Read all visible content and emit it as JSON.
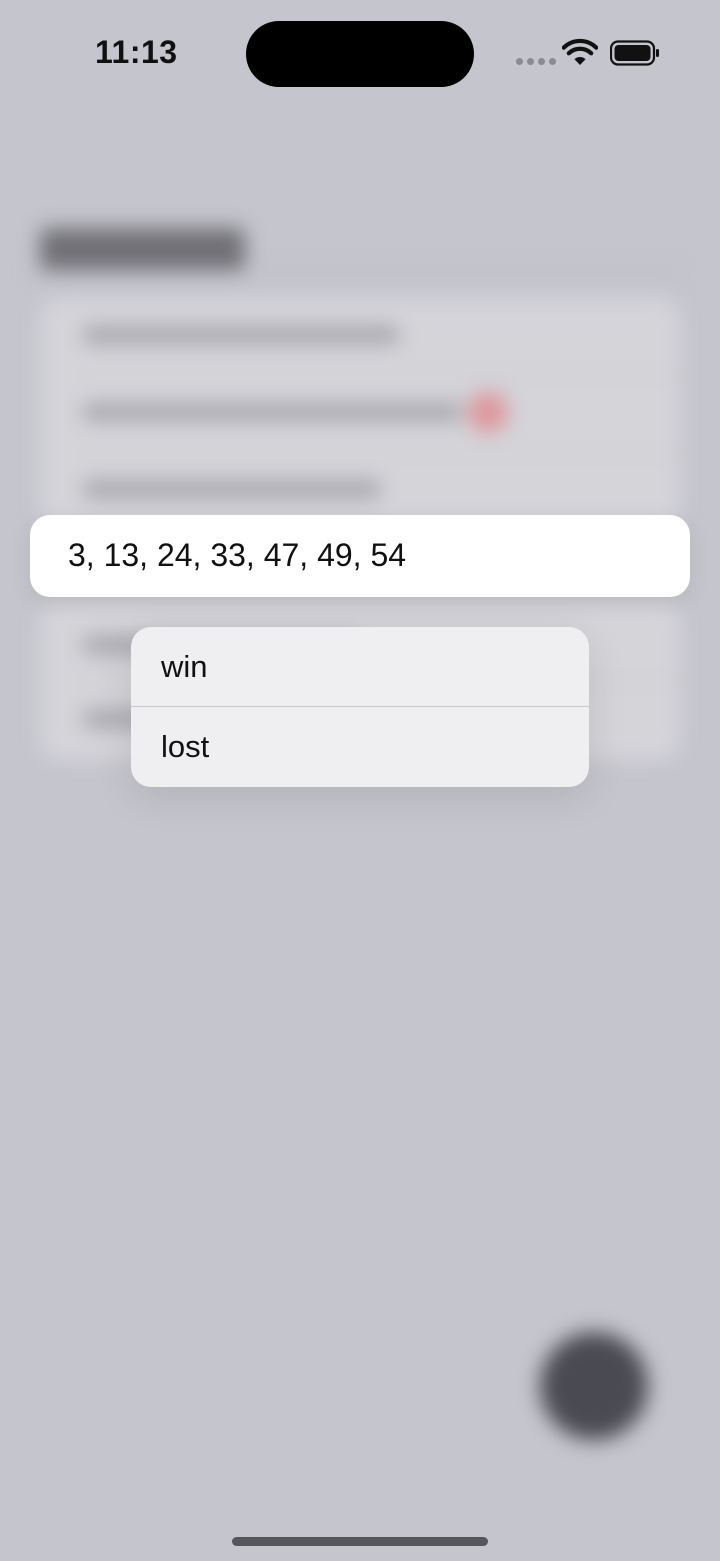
{
  "status_bar": {
    "time": "11:13",
    "icons": [
      "cellular-signal-icon",
      "wifi-icon",
      "battery-icon"
    ]
  },
  "highlighted_cell": {
    "text": "3, 13, 24, 33, 47, 49, 54"
  },
  "context_menu": {
    "items": [
      {
        "label": "win"
      },
      {
        "label": "lost"
      }
    ]
  },
  "colors": {
    "background_dim": "#c5c5cd",
    "menu_background": "#efeff1",
    "card_background": "#ffffff",
    "badge_red": "#e0858a",
    "fab": "#4a4a52"
  }
}
